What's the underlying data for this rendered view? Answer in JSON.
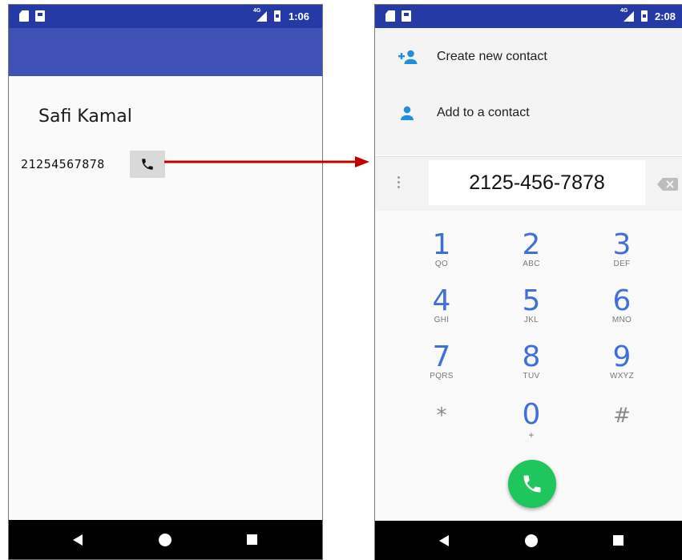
{
  "left_screen": {
    "status_bar": {
      "time": "1:06",
      "network": "4G"
    },
    "contact_name": "Safi Kamal",
    "contact_number": "21254567878",
    "call_button_icon": "phone-icon",
    "nav_bar": {
      "icons": [
        "back-icon",
        "home-icon",
        "recents-icon"
      ]
    }
  },
  "right_screen": {
    "status_bar": {
      "time": "2:08",
      "network": "4G"
    },
    "options": [
      {
        "label": "Create new contact",
        "icon": "add-person-icon"
      },
      {
        "label": "Add to a contact",
        "icon": "person-icon"
      }
    ],
    "dialed_number": "2125-456-7878",
    "keypad": [
      {
        "digit": "1",
        "letters": "QO"
      },
      {
        "digit": "2",
        "letters": "ABC"
      },
      {
        "digit": "3",
        "letters": "DEF"
      },
      {
        "digit": "4",
        "letters": "GHI"
      },
      {
        "digit": "5",
        "letters": "JKL"
      },
      {
        "digit": "6",
        "letters": "MNO"
      },
      {
        "digit": "7",
        "letters": "PQRS"
      },
      {
        "digit": "8",
        "letters": "TUV"
      },
      {
        "digit": "9",
        "letters": "WXYZ"
      },
      {
        "digit": "*",
        "letters": ""
      },
      {
        "digit": "0",
        "letters": "+"
      },
      {
        "digit": "#",
        "letters": ""
      }
    ],
    "colors": {
      "accent": "#3f6fd8",
      "call_button": "#1fc55d",
      "status_bar": "#263aa6",
      "app_bar": "#3f51b5"
    }
  },
  "arrow_color": "#c00000"
}
